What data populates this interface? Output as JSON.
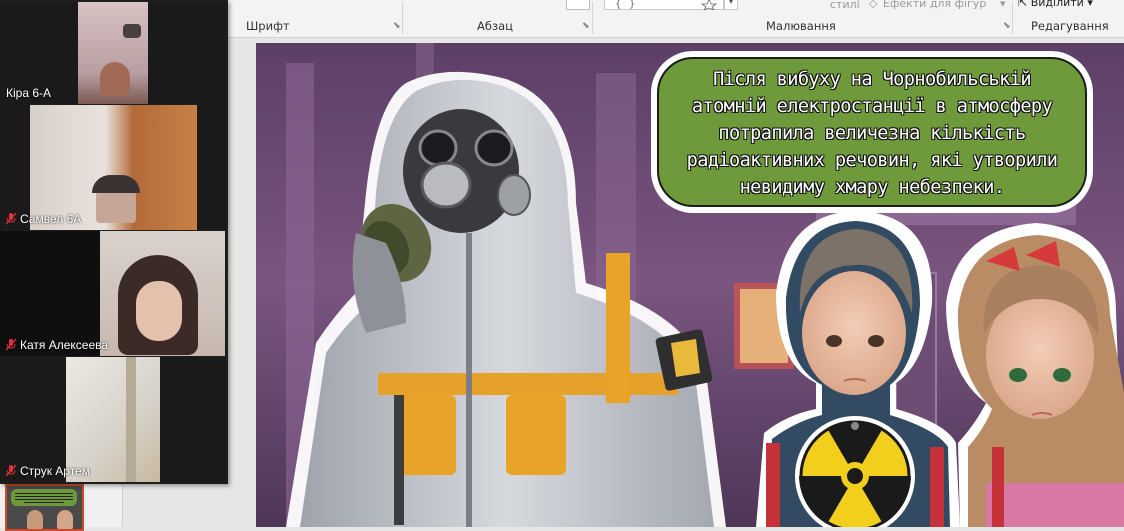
{
  "ribbon": {
    "groups": {
      "font": "Шрифт",
      "paragraph": "Абзац",
      "drawing": "Малювання",
      "editing": "Редагування"
    },
    "styles_label": "стилі",
    "shape_effects_label": "Ефекти для фігур",
    "select_label": "Виділити"
  },
  "participants": [
    {
      "name": "Кіра 6-А",
      "muted": false
    },
    {
      "name": "Самвел 6А",
      "muted": true
    },
    {
      "name": "Катя Алексеева",
      "muted": true
    },
    {
      "name": "Струк Артем",
      "muted": true
    }
  ],
  "slide": {
    "caption": "Після вибуху на Чорнобильській атомній електростанції в атмосферу потрапила величезна кількість радіоактивних речовин, які утворили невидиму хмару небезпеки.",
    "caption_lines": [
      "Після вибуху на Чорнобильській",
      "атомній електростанції в атмосферу",
      "потрапила величезна кількість",
      "радіоактивних речовин, які утворили",
      "невидиму хмару небезпеки."
    ]
  },
  "colors": {
    "bubble": "#6f9a3c",
    "slide_bg": "#6e4d74",
    "suit": "#c9ccd2",
    "strap": "#f0a21e",
    "muted_icon": "#e0303a"
  }
}
